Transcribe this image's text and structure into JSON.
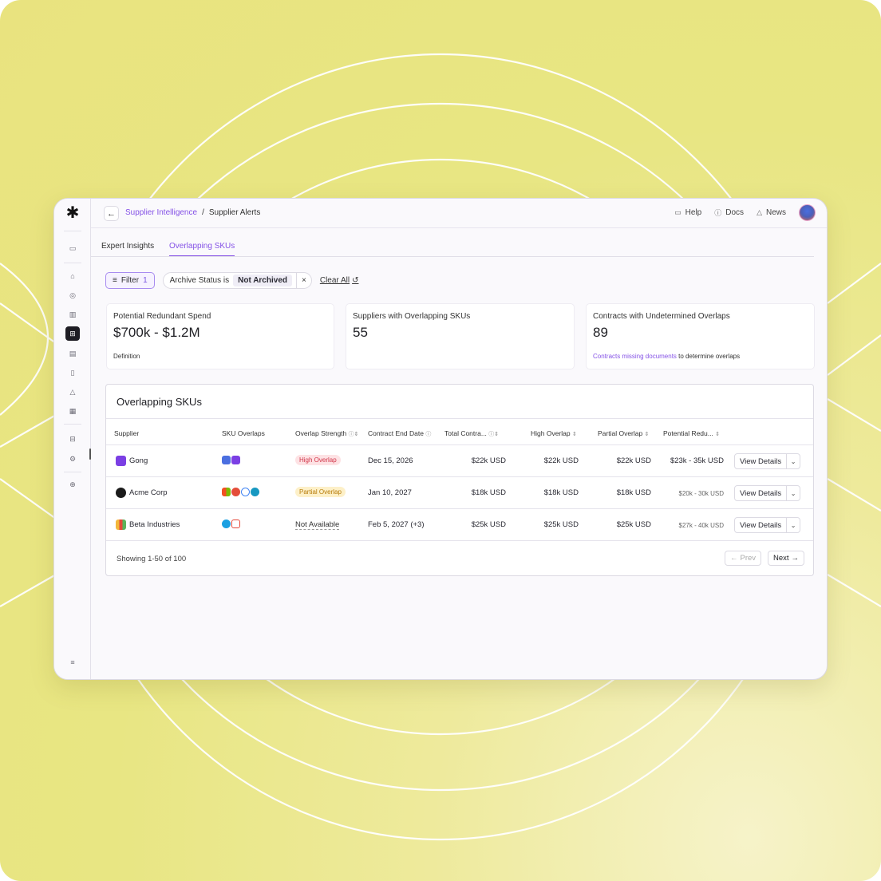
{
  "breadcrumb": {
    "parent": "Supplier Intelligence",
    "separator": "/",
    "current": "Supplier Alerts"
  },
  "topnav": {
    "help": "Help",
    "docs": "Docs",
    "news": "News"
  },
  "tabs": [
    {
      "label": "Expert Insights"
    },
    {
      "label": "Overlapping SKUs"
    }
  ],
  "filter": {
    "button_label": "Filter",
    "button_count": "1",
    "chip_field": "Archive Status is",
    "chip_value": "Not Archived",
    "chip_remove": "×",
    "clear_label": "Clear All"
  },
  "stats": [
    {
      "label": "Potential Redundant Spend",
      "value": "$700k - $1.2M",
      "footer_text": "Definition"
    },
    {
      "label": "Suppliers with Overlapping SKUs",
      "value": "55"
    },
    {
      "label": "Contracts with Undetermined Overlaps",
      "value": "89",
      "footer_link": "Contracts missing documents",
      "footer_text": " to determine overlaps"
    }
  ],
  "table": {
    "title": "Overlapping SKUs",
    "columns": [
      "Supplier",
      "SKU Overlaps",
      "Overlap Strength",
      "Contract End Date",
      "Total Contra...",
      "High Overlap",
      "Partial Overlap",
      "Potential Redu..."
    ],
    "rows": [
      {
        "supplier": "Gong",
        "strength": "High Overlap",
        "end_date": "Dec 15, 2026",
        "total": "$22k USD",
        "high": "$22k USD",
        "partial": "$22k USD",
        "redundant": "$23k - 35k USD",
        "action": "View Details"
      },
      {
        "supplier": "Acme Corp",
        "strength": "Partial Overlap",
        "end_date": "Jan 10, 2027",
        "total": "$18k USD",
        "high": "$18k USD",
        "partial": "$18k USD",
        "redundant": "$20k - 30k USD",
        "action": "View Details"
      },
      {
        "supplier": "Beta Industries",
        "strength": "Not Available",
        "end_date": "Feb 5, 2027 (+3)",
        "total": "$25k USD",
        "high": "$25k USD",
        "partial": "$25k USD",
        "redundant": "$27k - 40k USD",
        "action": "View Details"
      }
    ],
    "showing": "Showing 1-50 of 100",
    "prev": "Prev",
    "next": "Next"
  },
  "colors": {
    "accent": "#8552e6",
    "high_badge": "#d13448",
    "partial_badge": "#b77b09",
    "backdrop": "#e9e37f"
  },
  "icons": [
    "asterisk-logo",
    "back-arrow-icon",
    "chat-icon",
    "help-circle-icon",
    "bell-icon",
    "filter-icon",
    "refresh-icon",
    "info-icon",
    "sort-icon",
    "chevron-down-icon"
  ]
}
